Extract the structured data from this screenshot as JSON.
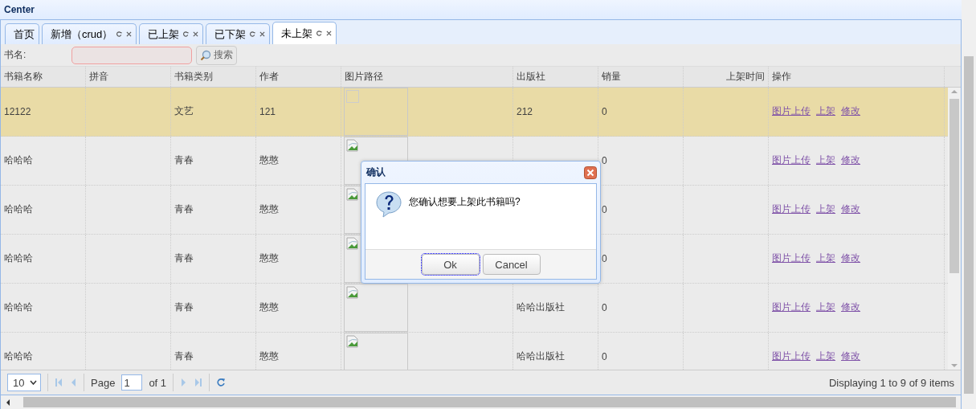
{
  "panel": {
    "title": "Center"
  },
  "tabs": [
    {
      "label": "首页",
      "closable": false,
      "selected": false
    },
    {
      "label": "新增（crud）",
      "closable": true,
      "selected": false
    },
    {
      "label": "已上架",
      "closable": true,
      "selected": false
    },
    {
      "label": "已下架",
      "closable": true,
      "selected": false
    },
    {
      "label": "未上架",
      "closable": true,
      "selected": true
    }
  ],
  "search": {
    "label": "书名:",
    "button": "搜索"
  },
  "table": {
    "columns": [
      {
        "label": "书籍名称"
      },
      {
        "label": "拼音"
      },
      {
        "label": "书籍类别"
      },
      {
        "label": "作者"
      },
      {
        "label": "图片路径"
      },
      {
        "label": "出版社"
      },
      {
        "label": "销量"
      },
      {
        "label": "上架时间"
      },
      {
        "label": "操作"
      }
    ],
    "rows": [
      {
        "selected": true,
        "name": "12122",
        "category": "文艺",
        "author": "121",
        "kind": "empty-image",
        "publisher": "212",
        "sales": "0",
        "actions": [
          "图片上传",
          "上架",
          "修改"
        ]
      },
      {
        "selected": false,
        "name": "哈哈哈",
        "category": "青春",
        "author": "憨憨",
        "kind": "broken-image",
        "sales": "0",
        "actions": [
          "图片上传",
          "上架",
          "修改"
        ]
      },
      {
        "selected": false,
        "name": "哈哈哈",
        "category": "青春",
        "author": "憨憨",
        "kind": "broken-image",
        "sales": "0",
        "actions": [
          "图片上传",
          "上架",
          "修改"
        ]
      },
      {
        "selected": false,
        "name": "哈哈哈",
        "category": "青春",
        "author": "憨憨",
        "kind": "broken-image",
        "sales": "0",
        "actions": [
          "图片上传",
          "上架",
          "修改"
        ]
      },
      {
        "selected": false,
        "name": "哈哈哈",
        "category": "青春",
        "author": "憨憨",
        "kind": "broken-image",
        "publisher": "哈哈出版社",
        "sales": "0",
        "actions": [
          "图片上传",
          "上架",
          "修改"
        ]
      },
      {
        "selected": false,
        "name": "哈哈哈",
        "category": "青春",
        "author": "憨憨",
        "kind": "broken-image",
        "publisher": "哈哈出版社",
        "sales": "0",
        "actions": [
          "图片上传",
          "上架",
          "修改"
        ]
      }
    ]
  },
  "pager": {
    "page_size": "10",
    "page_label": "Page",
    "page": "1",
    "page_count": "of 1",
    "info": "Displaying 1 to 9 of 9 items"
  },
  "dialog": {
    "title": "确认",
    "message": "您确认想要上架此书籍吗?",
    "buttons": [
      {
        "label": "Ok",
        "focused": true
      },
      {
        "label": "Cancel",
        "focused": false
      }
    ]
  }
}
